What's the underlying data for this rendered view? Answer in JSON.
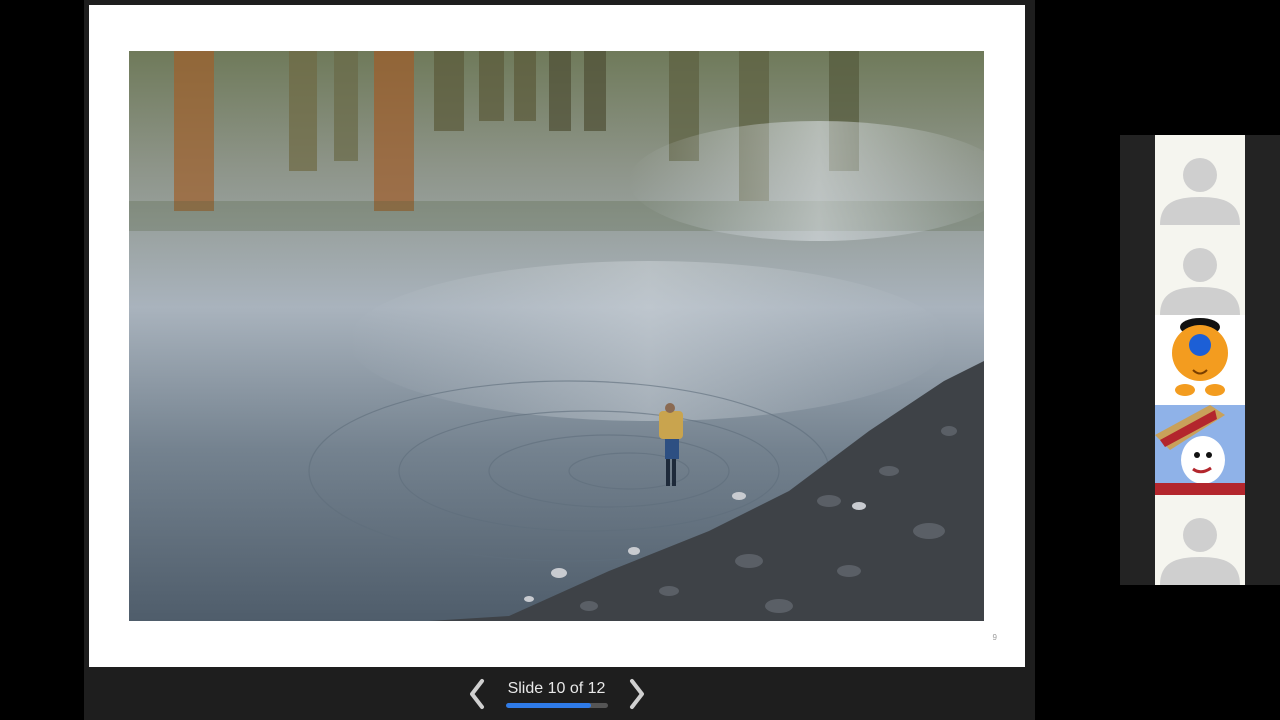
{
  "presentation": {
    "slide_counter": "Slide 10 of 12",
    "current_slide": 10,
    "total_slides": 12,
    "progress_fraction": 0.8333,
    "slide_page_number": "9",
    "accent_color": "#2f7be8"
  },
  "navigation": {
    "prev_icon": "chevron-left-icon",
    "next_icon": "chevron-right-icon"
  },
  "participants": [
    {
      "avatar": "default-person-icon"
    },
    {
      "avatar": "default-person-icon"
    },
    {
      "avatar": "orange-cartoon-character"
    },
    {
      "avatar": "cartoon-character-with-hat"
    },
    {
      "avatar": "default-person-icon"
    }
  ]
}
